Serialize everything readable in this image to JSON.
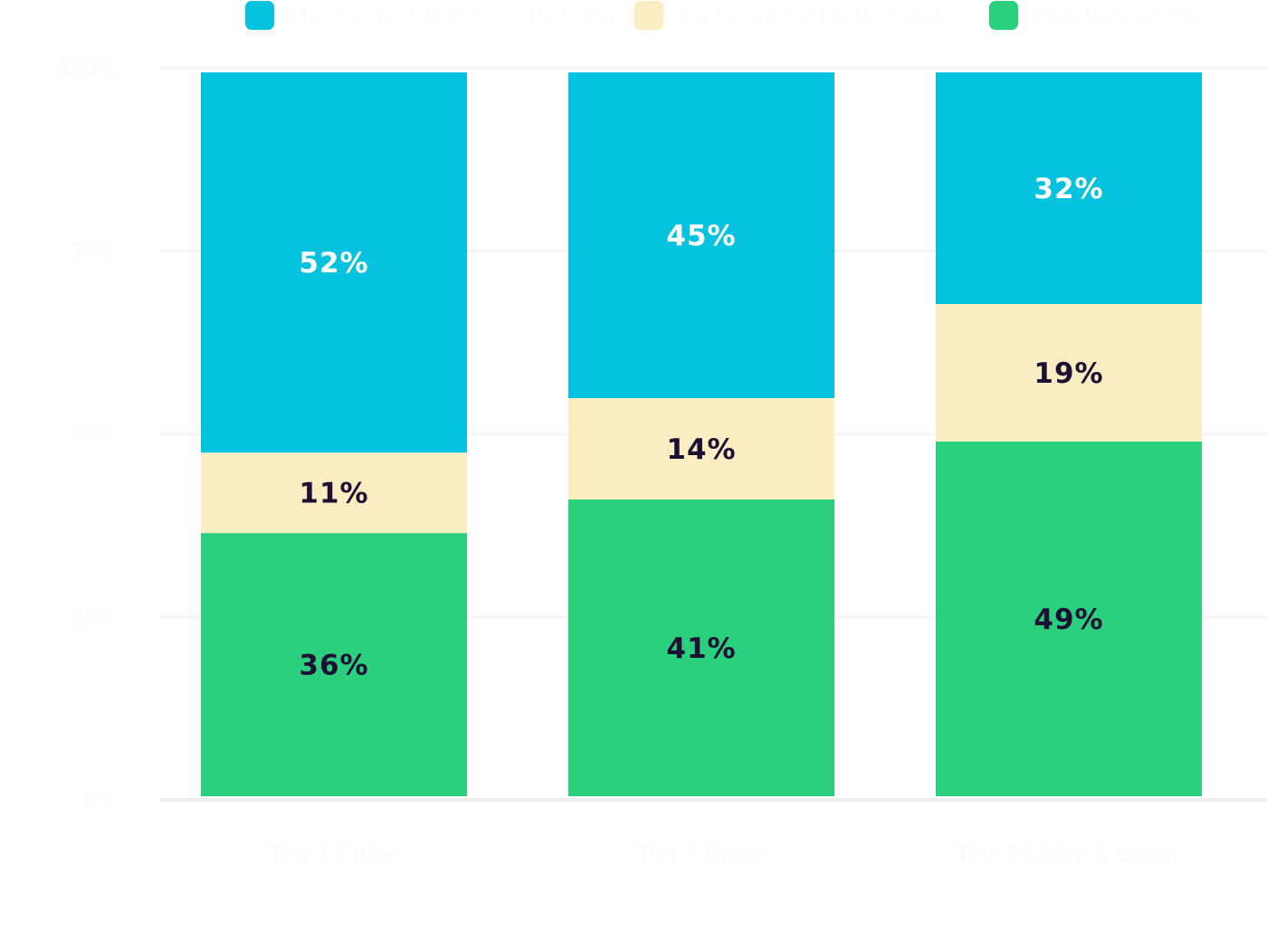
{
  "chart_data": {
    "type": "bar",
    "stacked": true,
    "title": "",
    "xlabel": "",
    "ylabel": "",
    "ylim": [
      0,
      100
    ],
    "y_ticks": [
      "0%",
      "25%",
      "50%",
      "75%",
      "100%"
    ],
    "grid": true,
    "legend_position": "top",
    "categories": [
      "Tier 1 Cities",
      "Tier 2 Cities",
      "Tier 3 Cities & Lower"
    ],
    "series": [
      {
        "name": "Remittances/Pool",
        "color": "#2ad07e",
        "label_color": "#1e1035",
        "values": [
          36,
          41,
          49
        ]
      },
      {
        "name": "Exchange (Gift & Payments)",
        "color": "#f9edc1",
        "label_color": "#1e1035",
        "values": [
          11,
          14,
          19
        ]
      },
      {
        "name": "Merchants (Full-Time or Part-time)",
        "color": "#05c3df",
        "label_color": "#ffffff",
        "values": [
          52,
          45,
          32
        ]
      }
    ],
    "legend_order": [
      2,
      1,
      0
    ],
    "data_label_suffix": "%"
  },
  "colors": {
    "gridline": "#f5f5f5",
    "baseline": "#efefef",
    "axis_text": "#fbfbfb"
  }
}
